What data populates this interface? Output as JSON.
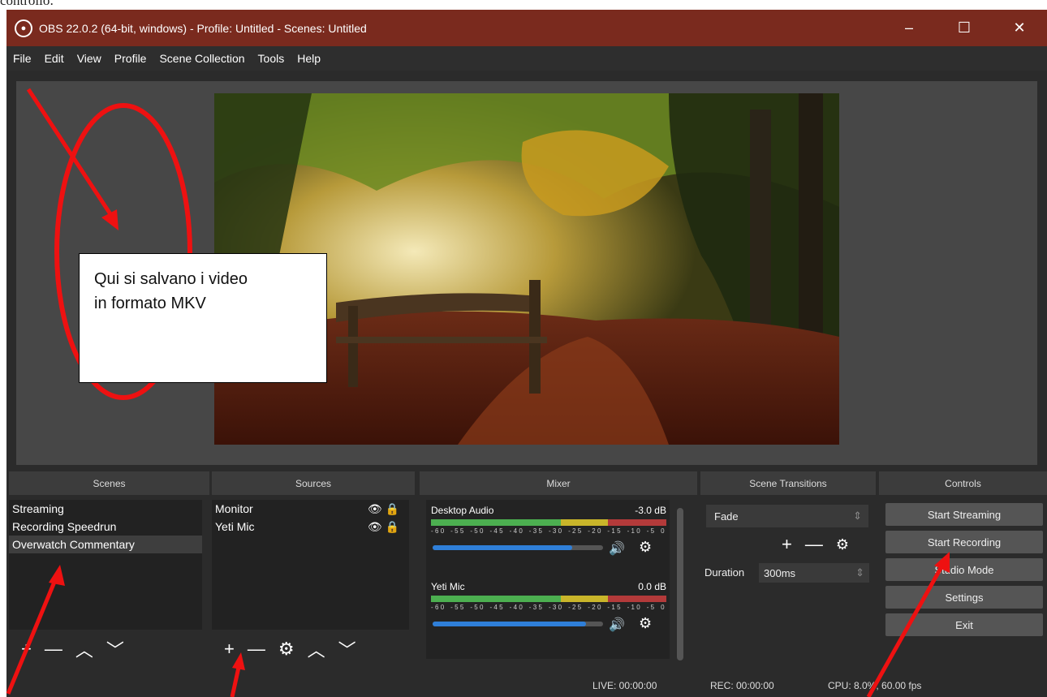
{
  "doc_fragment": "controllo:",
  "window": {
    "title": "OBS 22.0.2 (64-bit, windows) - Profile: Untitled - Scenes: Untitled",
    "minimize": "–",
    "maximize": "☐",
    "close": "✕"
  },
  "menu": [
    "File",
    "Edit",
    "View",
    "Profile",
    "Scene Collection",
    "Tools",
    "Help"
  ],
  "panels": {
    "scenes": {
      "header": "Scenes",
      "items": [
        "Streaming",
        "Recording Speedrun",
        "Overwatch Commentary"
      ],
      "selected_index": 2
    },
    "sources": {
      "header": "Sources",
      "items": [
        "Monitor",
        "Yeti Mic"
      ]
    },
    "mixer": {
      "header": "Mixer",
      "channels": [
        {
          "name": "Desktop Audio",
          "db": "-3.0 dB",
          "level": 0.82
        },
        {
          "name": "Yeti Mic",
          "db": "0.0 dB",
          "level": 0.9
        }
      ],
      "scale": [
        "-60",
        "-55",
        "-50",
        "-45",
        "-40",
        "-35",
        "-30",
        "-25",
        "-20",
        "-15",
        "-10",
        "-5",
        "0"
      ]
    },
    "transitions": {
      "header": "Scene Transitions",
      "selected": "Fade",
      "duration_label": "Duration",
      "duration_value": "300ms"
    },
    "controls": {
      "header": "Controls",
      "buttons": [
        "Start Streaming",
        "Start Recording",
        "Studio Mode",
        "Settings",
        "Exit"
      ]
    }
  },
  "status": {
    "live": "LIVE: 00:00:00",
    "rec": "REC: 00:00:00",
    "cpu": "CPU: 8.0%, 60.00 fps"
  },
  "annotation": {
    "line1": "Qui si salvano i video",
    "line2": "in formato MKV"
  },
  "colors": {
    "titlebar": "#7a2a1e",
    "annotation_red": "#ee1111",
    "meter_green": "#4caf50",
    "meter_yellow": "#c9b52a",
    "meter_red": "#b33a3a",
    "slider_blue": "#2f7fd8"
  }
}
